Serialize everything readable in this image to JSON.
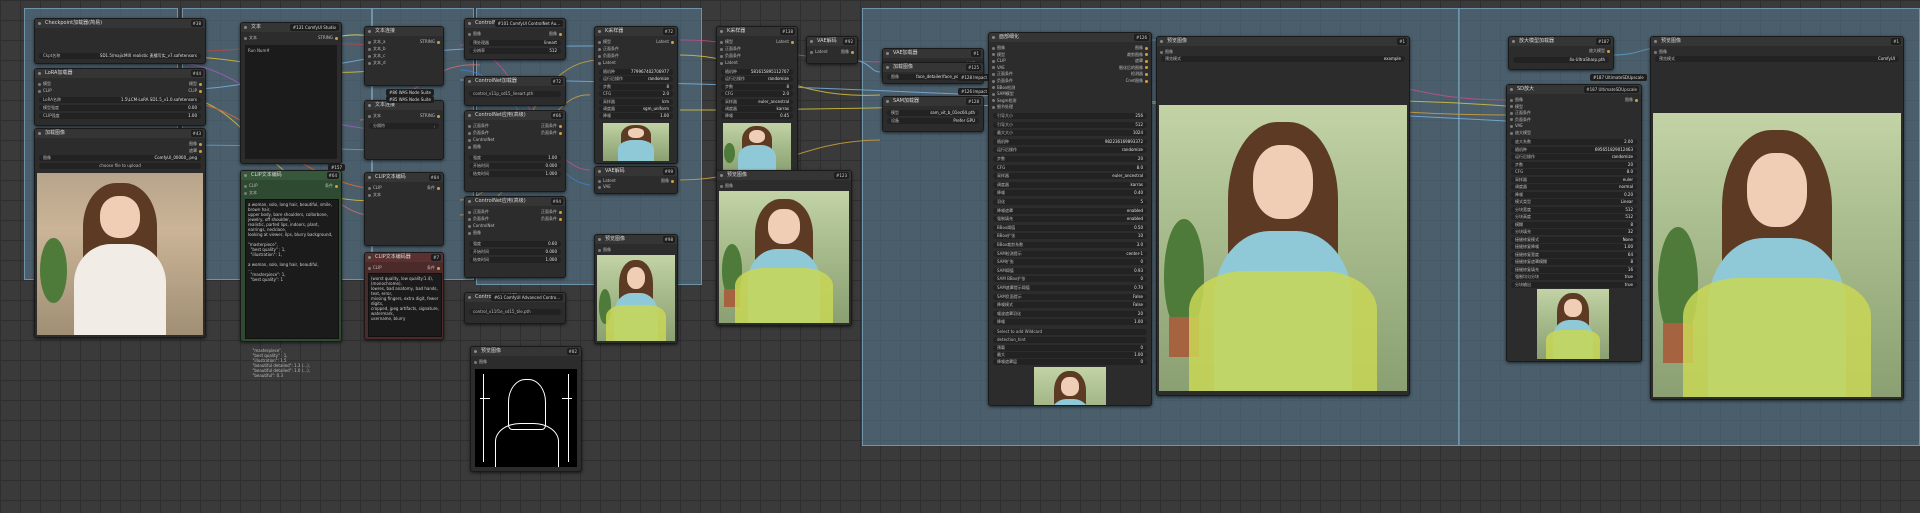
{
  "groups": {
    "g1": "",
    "g2": "",
    "g3": "",
    "g4": "",
    "g5": "",
    "g6": ""
  },
  "n1": {
    "title": "Checkpoint加载器(简易)",
    "badge": "#38",
    "widget_label": "Ckpt名称",
    "widget_value": "SD1.5/majicMIX realistic 麦橘写实_v7.safetensors"
  },
  "n2": {
    "title": "LoRA加载器",
    "badge": "#44",
    "in1": "模型",
    "in2": "CLIP",
    "out1": "模型",
    "out2": "CLIP",
    "w1_label": "LoRA名称",
    "w1_value": "1.5\\LCM-LoRA SD1.5_v1.0.safetensors",
    "w2_label": "模型强度",
    "w2_value": "0.00",
    "w3_label": "CLIP强度",
    "w3_value": "1.00"
  },
  "n3": {
    "title": "加载图像",
    "badge": "#43",
    "out1": "图像",
    "out2": "遮罩",
    "w1_label": "图像",
    "w1_value": "ComfyUI_00060_.png",
    "upload": "choose file to upload"
  },
  "n4": {
    "title": "文本",
    "badge": "#131 ComfyUI Studio",
    "in1": "文本",
    "out1": "STRING",
    "body": "Run Num#"
  },
  "n5": {
    "title": "CLIP文本编码",
    "badge": "#64",
    "in1": "CLIP",
    "in2": "文本",
    "out1": "条件",
    "tag": "#157",
    "body": "a woman, solo, long hair, beautiful, smile, brown hair,\nupper body, bare shoulders, collarbone, jewelry, off shoulder,\nrealistic, parted lips, indoors, plant, earrings, necklace,\nlooking at viewer, lips, blurry background,\n\n\"masterpiece\",\n  \"best quality\" : 1,\n  \"illustration\": 1,\n\na woman, solo, long hair, beautiful,\n...\n  \"masterpiece\": 1,\n  \"best quality\": 1"
  },
  "n6": {
    "title": "文本连接",
    "badge": "#68",
    "in1": "文本_a",
    "in2": "文本_b",
    "in3": "文本_c",
    "in4": "文本_d",
    "out1": "STRING"
  },
  "n7": {
    "title": "WAS Node Suite",
    "tag": "#86 WAS Node Suite"
  },
  "n8": {
    "title": "WAS Node Suite",
    "tag": "#85 WAS Node Suite"
  },
  "n9": {
    "title": "文本连接",
    "in1": "文本",
    "out1": "STRING",
    "w1_label": "分隔符",
    "w1_value": ", "
  },
  "n10": {
    "title": "CLIP文本编码",
    "badge": "#84",
    "in1": "CLIP",
    "in2": "文本",
    "out1": "条件"
  },
  "n11": {
    "title": "CLIP文本编码器",
    "badge": "#7",
    "in1": "CLIP",
    "out1": "条件",
    "body": "(worst quality, low quality:1.4), (monochrome), \nlowres, bad anatomy, bad hands, text, error,\nmissing fingers, extra digit, fewer digits,\ncropped, jpeg artifacts, signature, watermark,\nusername, blurry"
  },
  "n12": {
    "title": "ControlNet应用(高级)",
    "badge": "#101 ComfyUI ControlNet Au...",
    "in1": "图像",
    "out1": "图像",
    "w1_label": "预处理器",
    "w1_value": "lineart",
    "w2_label": "分辨率",
    "w2_value": "512"
  },
  "n13": {
    "title": "ControlNet加载器",
    "badge": "#72",
    "out1": "ControlNet",
    "w1_value": "control_v11p_sd15_lineart.pth"
  },
  "n14": {
    "title": "ControlNet应用(高级)",
    "badge": "#66",
    "in1": "正面条件",
    "in2": "负面条件",
    "in3": "ControlNet",
    "in4": "图像",
    "out1": "正面条件",
    "out2": "负面条件",
    "w1_label": "强度",
    "w1_value": "1.00",
    "w2_label": "开始时间",
    "w2_value": "0.000",
    "w3_label": "结束时间",
    "w3_value": "1.000"
  },
  "n15": {
    "title": "ControlNet应用(高级)",
    "badge": "#94",
    "in1": "正面条件",
    "in2": "负面条件",
    "in3": "ControlNet",
    "in4": "图像",
    "out1": "正面条件",
    "out2": "负面条件",
    "w1_label": "强度",
    "w1_value": "0.60",
    "w2_label": "开始时间",
    "w2_value": "0.000",
    "w3_label": "结束时间",
    "w3_value": "1.000"
  },
  "n16": {
    "title": "ControlNet加载器",
    "badge": "#61 ComfyUI Advanced Contro...",
    "w1_value": "control_v11f1e_sd15_tile.pth"
  },
  "n17": {
    "title": "预览图像",
    "badge": "#82",
    "in1": "图像"
  },
  "n18": {
    "title": "K采样器",
    "badge": "#72",
    "in1": "模型",
    "in2": "正面条件",
    "in3": "负面条件",
    "in4": "Latent",
    "out1": "Latent",
    "rows": [
      [
        "随机种",
        "779967402706977"
      ],
      [
        "运行后操作",
        "randomize"
      ],
      [
        "步数",
        "8"
      ],
      [
        "CFG",
        "2.0"
      ],
      [
        "采样器",
        "lcm"
      ],
      [
        "调度器",
        "sgm_uniform"
      ],
      [
        "降噪",
        "1.00"
      ]
    ]
  },
  "n19": {
    "title": "VAE解码",
    "badge": "#99",
    "in1": "Latent",
    "in2": "VAE",
    "out1": "图像"
  },
  "n20": {
    "title": "预览图像",
    "badge": "#98",
    "in1": "图像"
  },
  "n21": {
    "title": "K采样器",
    "badge": "#138",
    "in1": "模型",
    "in2": "正面条件",
    "in3": "负面条件",
    "in4": "Latent",
    "out1": "Latent",
    "rows": [
      [
        "随机种",
        "581615895112707"
      ],
      [
        "运行后操作",
        "randomize"
      ],
      [
        "步数",
        "8"
      ],
      [
        "CFG",
        "2.0"
      ],
      [
        "采样器",
        "euler_ancestral"
      ],
      [
        "调度器",
        "karras"
      ],
      [
        "降噪",
        "0.45"
      ]
    ]
  },
  "n22": {
    "title": "VAE解码",
    "badge": "#92",
    "in1": "Latent",
    "out1": "图像"
  },
  "n23": {
    "title": "预览图像",
    "badge": "#123",
    "in1": "图像"
  },
  "n24": {
    "title": "VAE加载器",
    "badge": "#1",
    "out1": "VAE"
  },
  "n25": {
    "title": "加载图像",
    "badge": "#125",
    "in1": "图像",
    "w1_label": "图像",
    "w1_value": "face_detailer/face_yolov8n.pt"
  },
  "n26": {
    "title": "SAM加载器",
    "badge": "#128",
    "w1_label": "模型",
    "w1_value": "sam_vit_b_01ec64.pth",
    "w2_label": "设备",
    "w2_value": "Prefer GPU"
  },
  "n27": {
    "title": "面部细化",
    "badge": "#126",
    "tag": "#128 Impact Pack",
    "tag2": "#126 Impact Pack",
    "inputs": [
      "图像",
      "模型",
      "CLIP",
      "VAE",
      "正面条件",
      "负面条件",
      "BBox检测",
      "SAM模型",
      "Segm检测",
      "细节处理"
    ],
    "outputs": [
      "图像",
      "裁剪图像",
      "遮罩",
      "细化后的图像",
      "检测器",
      "Cnet图像"
    ],
    "rows": [
      [
        "引导大小",
        "256"
      ],
      [
        "引导大小",
        "512"
      ],
      [
        "最大大小",
        "1024"
      ],
      [
        "随机种",
        "982236169893372"
      ],
      [
        "运行后操作",
        "randomize"
      ],
      [
        "步数",
        "20"
      ],
      [
        "CFG",
        "8.0"
      ],
      [
        "采样器",
        "euler_ancestral"
      ],
      [
        "调度器",
        "karras"
      ],
      [
        "降噪",
        "0.40"
      ],
      [
        "羽化",
        "5"
      ],
      [
        "降噪遮罩",
        "enabled"
      ],
      [
        "强制填充",
        "enabled"
      ],
      [
        "BBox阈值",
        "0.50"
      ],
      [
        "BBox扩张",
        "10"
      ],
      [
        "BBox裁剪系数",
        "3.0"
      ],
      [
        "SAM检测提示",
        "center-1"
      ],
      [
        "SAM扩张",
        "0"
      ],
      [
        "SAM阈值",
        "0.93"
      ],
      [
        "SAM BBox扩张",
        "0"
      ],
      [
        "SAM遮罩提示阈值",
        "0.70"
      ],
      [
        "SAM负面提示",
        "False"
      ],
      [
        "降噪模式",
        "False"
      ],
      [
        "噪波遮罩羽化",
        "20"
      ],
      [
        "降噪",
        "1.00"
      ]
    ],
    "wildcard_label": "Select to add Wildcard",
    "wildcard": "detection_hint",
    "bottom_rows": [
      [
        "预载",
        "0"
      ],
      [
        "最大",
        "1.00"
      ],
      [
        "降噪遮罩层",
        "0"
      ]
    ]
  },
  "n28": {
    "title": "预览图像",
    "badge": "#1",
    "in1": "图像",
    "w1_label": "预览模式",
    "w1_value": "example"
  },
  "n29": {
    "title": "放大模型加载器",
    "badge": "#187",
    "out1": "放大模型",
    "w1_value": "4x-UltraSharp.pth"
  },
  "n30": {
    "title": "SD放大",
    "badge": "#187 UltimateSDUpscale",
    "tag": "#187 UltimateSDUpscale",
    "inputs": [
      "图像",
      "模型",
      "正面条件",
      "负面条件",
      "VAE",
      "放大模型"
    ],
    "outputs": [
      "图像"
    ],
    "rows": [
      [
        "放大系数",
        "2.00"
      ],
      [
        "随机种",
        "695651829012463"
      ],
      [
        "运行后操作",
        "randomize"
      ],
      [
        "步数",
        "20"
      ],
      [
        "CFG",
        "8.0"
      ],
      [
        "采样器",
        "euler"
      ],
      [
        "调度器",
        "normal"
      ],
      [
        "降噪",
        "0.20"
      ],
      [
        "模式类型",
        "Linear"
      ],
      [
        "分块宽度",
        "512"
      ],
      [
        "分块高度",
        "512"
      ],
      [
        "模糊",
        "8"
      ],
      [
        "分块填充",
        "32"
      ],
      [
        "接缝修复模式",
        "None"
      ],
      [
        "接缝修复降噪",
        "1.00"
      ],
      [
        "接缝修复宽度",
        "64"
      ],
      [
        "接缝修复遮罩模糊",
        "8"
      ],
      [
        "接缝修复填充",
        "16"
      ],
      [
        "强制均匀分块",
        "true"
      ],
      [
        "分块输出",
        "true"
      ]
    ]
  },
  "n31": {
    "title": "预览图像",
    "badge": "#1",
    "in1": "图像",
    "w1_label": "预览模式",
    "w1_value": "ComfyUI"
  },
  "note_text": "  \"masterpiece\",\n  \"best quality\" : 1,\n  \"illustration\": 1.5\n  \"beautiful detailed\": 1.3 (...),\n  \"beautiful detailed\": 1.0 (...),\n  \"beautiful\": 0.3"
}
